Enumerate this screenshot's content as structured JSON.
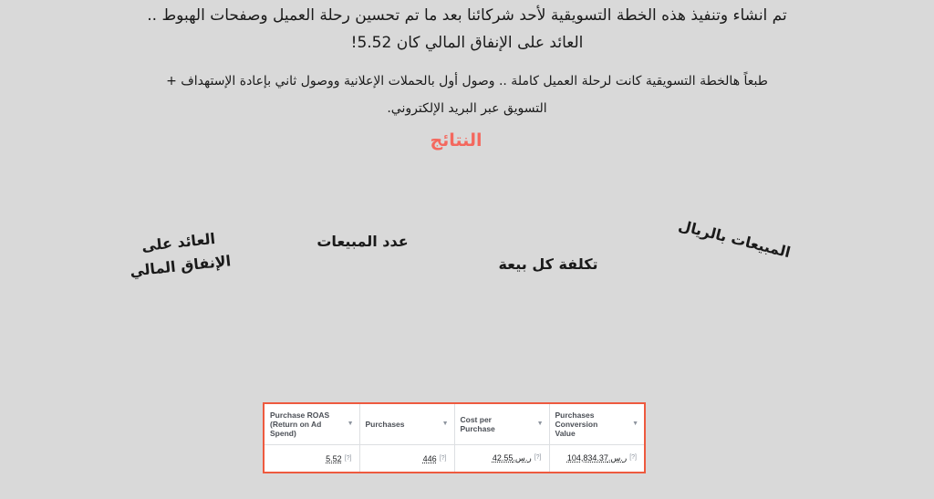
{
  "intro": {
    "line1": "تم انشاء وتنفيذ هذه الخطة التسويقية لأحد شركائنا بعد ما تم تحسين رحلة العميل وصفحات الهبوط ..",
    "line2": "العائد على الإنفاق المالي كان 5.52!"
  },
  "subtitle": {
    "line1": "طبعاً هالخطة التسويقية كانت لرحلة العميل كاملة .. وصول أول بالحملات الإعلانية ووصول ثاني بإعادة الإستهداف +",
    "line2": "التسويق عبر البريد الإلكتروني."
  },
  "results_heading": "النتائج",
  "labels": {
    "roas_line1": "العائد على",
    "roas_line2": "الإنفاق المالي",
    "purchases": "عدد المبيعات",
    "cost_per_sale": "تكلفة كل بيعة",
    "sales_sar": "المبيعات بالريال"
  },
  "table": {
    "headers": [
      {
        "line1": "Purchase ROAS",
        "line2": "(Return on Ad",
        "line3": "Spend)"
      },
      {
        "line1": "Purchases",
        "line2": "",
        "line3": ""
      },
      {
        "line1": "Cost per",
        "line2": "Purchase",
        "line3": ""
      },
      {
        "line1": "Purchases",
        "line2": "Conversion",
        "line3": "Value"
      }
    ],
    "row": [
      "5.52",
      "446",
      "ر.س.42.55",
      "ر.س.104,834.37"
    ]
  },
  "colors": {
    "accent": "#f4685e",
    "table_border": "#ee5a3f",
    "background": "#d9d9d9"
  }
}
